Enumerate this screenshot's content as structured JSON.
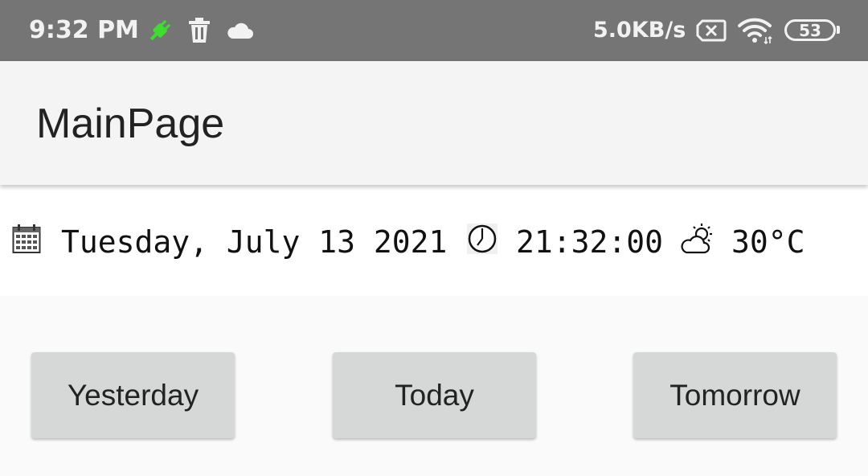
{
  "status_bar": {
    "time": "9:32 PM",
    "network_speed": "5.0KB/s",
    "battery_level": "53",
    "icons": [
      "usb-plug-icon",
      "trash-icon",
      "cloud-icon",
      "no-sim-icon",
      "wifi-icon",
      "battery-icon"
    ],
    "colors": {
      "background": "#757575",
      "plug_accent": "#3ddc2f"
    }
  },
  "app_bar": {
    "title": "MainPage"
  },
  "info": {
    "date": "Tuesday, July 13 2021",
    "time": "21:32:00",
    "temperature": "30°C",
    "icons": [
      "calendar-icon",
      "clock-icon",
      "partly-cloudy-icon"
    ]
  },
  "buttons": {
    "yesterday": "Yesterday",
    "today": "Today",
    "tomorrow": "Tomorrow"
  }
}
